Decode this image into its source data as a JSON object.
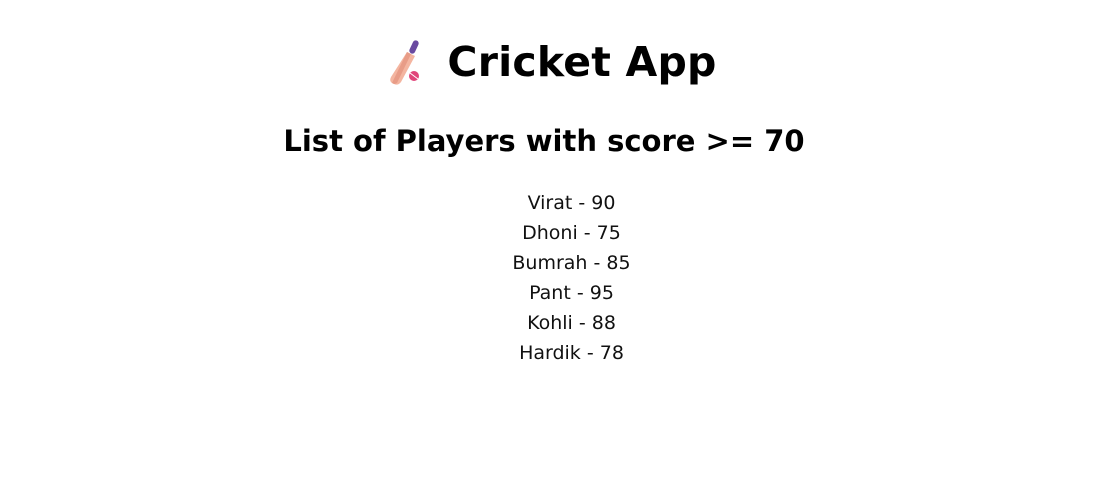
{
  "app": {
    "title": "Cricket App",
    "icon": "cricket-bat-icon"
  },
  "section": {
    "heading": "List of Players with score >= 70"
  },
  "players": [
    {
      "text": "Virat - 90"
    },
    {
      "text": "Dhoni - 75"
    },
    {
      "text": "Bumrah - 85"
    },
    {
      "text": "Pant - 95"
    },
    {
      "text": "Kohli - 88"
    },
    {
      "text": "Hardik - 78"
    }
  ],
  "colors": {
    "background": "#ffffff",
    "text": "#000000",
    "bat_handle": "#6a4aa0",
    "bat_blade": "#f4b5a0",
    "ball": "#e0457a"
  }
}
